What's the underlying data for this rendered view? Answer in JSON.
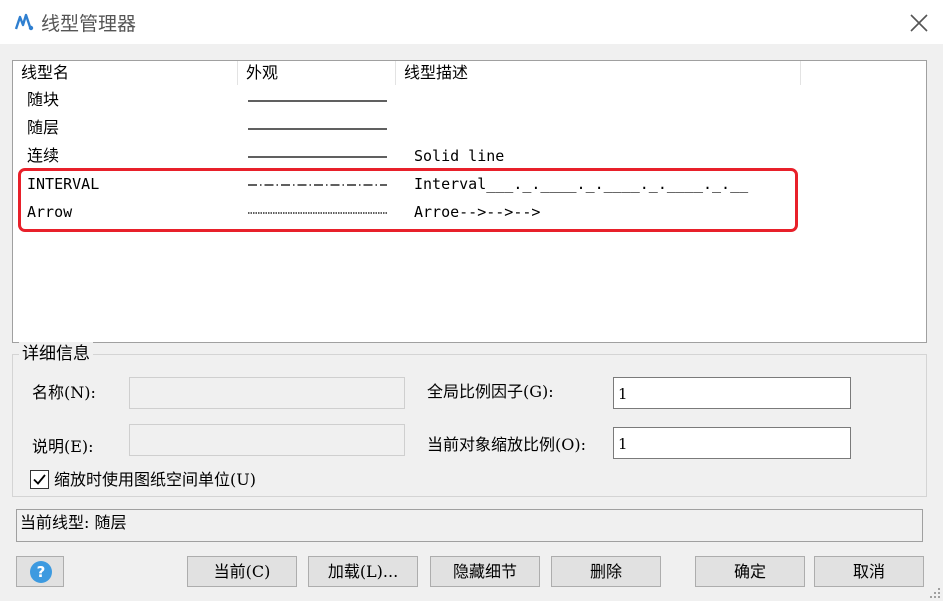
{
  "window": {
    "title": "线型管理器",
    "app_icon": "linetype-app-icon",
    "close_icon": "close-x-icon"
  },
  "list": {
    "columns": [
      "线型名",
      "外观",
      "线型描述"
    ],
    "rows": [
      {
        "name": "随块",
        "appearance": "solid",
        "description": ""
      },
      {
        "name": "随层",
        "appearance": "solid",
        "description": ""
      },
      {
        "name": "连续",
        "appearance": "solid",
        "description": "Solid line"
      },
      {
        "name": "INTERVAL",
        "appearance": "dash-dot",
        "description": "Interval___._.____._.____._.____._.__"
      },
      {
        "name": "Arrow",
        "appearance": "arrow",
        "description": "Arroe-->-->-->"
      }
    ],
    "highlight_color": "#e8202a"
  },
  "details": {
    "legend": "详细信息",
    "name_label": "名称(N):",
    "name_value": "",
    "desc_label": "说明(E):",
    "desc_value": "",
    "global_scale_label": "全局比例因子(G):",
    "global_scale_value": "1",
    "object_scale_label": "当前对象缩放比例(O):",
    "object_scale_value": "1",
    "paper_space_label": "缩放时使用图纸空间单位(U)",
    "paper_space_checked": true
  },
  "status": {
    "current_linetype": "当前线型: 随层"
  },
  "buttons": {
    "help": "?",
    "current": "当前(C)",
    "load": "加载(L)...",
    "hide_details": "隐藏细节",
    "delete": "删除",
    "ok": "确定",
    "cancel": "取消"
  },
  "colors": {
    "help_blue": "#3d9ae0",
    "button_bg": "#e1e1e1"
  }
}
